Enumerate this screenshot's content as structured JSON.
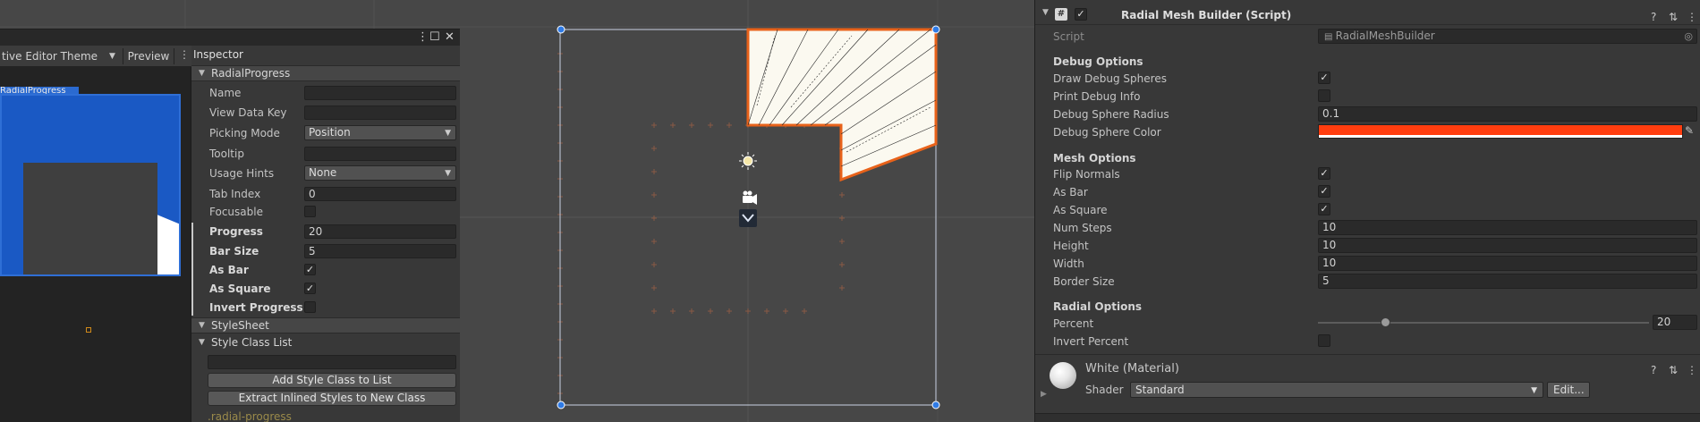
{
  "ui_builder": {
    "theme_select": "tive Editor Theme",
    "preview_button": "Preview",
    "canvas_label": "RadialProgress",
    "inspector_title": "Inspector",
    "element_foldout": "RadialProgress",
    "properties": [
      {
        "label": "Name",
        "value": ""
      },
      {
        "label": "View Data Key",
        "value": ""
      },
      {
        "label": "Picking Mode",
        "value": "Position"
      },
      {
        "label": "Tooltip",
        "value": ""
      },
      {
        "label": "Usage Hints",
        "value": "None"
      },
      {
        "label": "Tab Index",
        "value": "0"
      },
      {
        "label": "Focusable",
        "value": ""
      },
      {
        "label": "Progress",
        "value": "20"
      },
      {
        "label": "Bar Size",
        "value": "5"
      },
      {
        "label": "As Bar",
        "value": ""
      },
      {
        "label": "As Square",
        "value": ""
      },
      {
        "label": "Invert Progress",
        "value": ""
      }
    ],
    "stylesheet_foldout": "StyleSheet",
    "style_class_list_foldout": "Style Class List",
    "add_class_button": "Add Style Class to List",
    "extract_button": "Extract Inlined Styles to New Class",
    "class_pill": ".radial-progress"
  },
  "inspector": {
    "component_title": "Radial Mesh Builder (Script)",
    "script_label": "Script",
    "script_value": "RadialMeshBuilder",
    "debug_section": "Debug Options",
    "draw_debug_spheres": "Draw Debug Spheres",
    "print_debug_info": "Print Debug Info",
    "debug_sphere_radius": "Debug Sphere Radius",
    "debug_sphere_radius_value": "0.1",
    "debug_sphere_color": "Debug Sphere Color",
    "debug_color_hex": "#ff3d0f",
    "mesh_section": "Mesh Options",
    "flip_normals": "Flip Normals",
    "as_bar": "As Bar",
    "as_square": "As Square",
    "num_steps": "Num Steps",
    "num_steps_value": "10",
    "height": "Height",
    "height_value": "10",
    "width": "Width",
    "width_value": "10",
    "border_size": "Border Size",
    "border_size_value": "5",
    "radial_section": "Radial Options",
    "percent": "Percent",
    "percent_value": "20",
    "invert_percent": "Invert Percent",
    "material_title": "White (Material)",
    "shader_label": "Shader",
    "shader_value": "Standard",
    "edit_button": "Edit..."
  },
  "icons": {
    "check": "✓",
    "dropdown_arrow": "▼",
    "foldout_open": "▼"
  },
  "colors": {
    "selection_blue": "#1a59c4",
    "mesh_fill": "#fbf9f0",
    "mesh_outline": "#e8621a",
    "debug_color": "#ff3d0f",
    "handle_blue": "#2f7be6"
  }
}
